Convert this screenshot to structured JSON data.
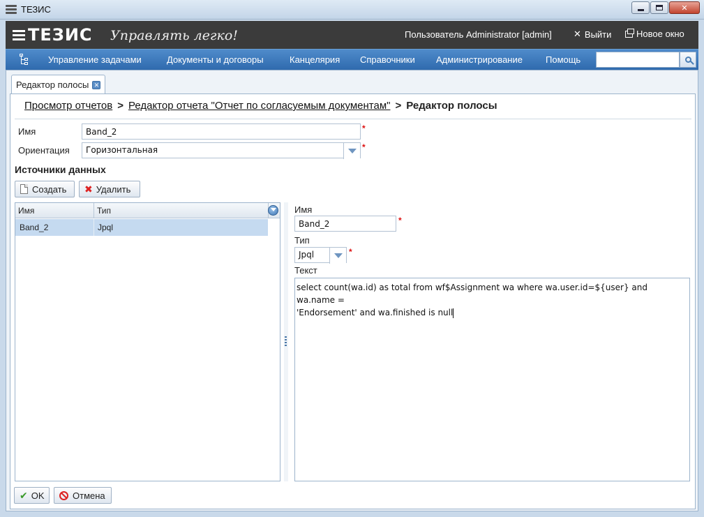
{
  "window": {
    "title": "ТЕЗИС",
    "minimize_label": "",
    "maximize_label": "",
    "close_label": "✕"
  },
  "header": {
    "logo": "ТЕЗИС",
    "slogan": "Управлять легко!",
    "user": "Пользователь Administrator [admin]",
    "exit_label": "Выйти",
    "new_window_label": "Новое окно"
  },
  "menu": {
    "items": [
      "Управление задачами",
      "Документы и договоры",
      "Канцелярия",
      "Справочники",
      "Администрирование",
      "Помощь"
    ],
    "search_placeholder": ""
  },
  "tab": {
    "label": "Редактор полосы"
  },
  "breadcrumb": {
    "link1": "Просмотр отчетов",
    "sep": ">",
    "link2": "Редактор отчета \"Отчет по согласуемым документам\"",
    "current": "Редактор полосы"
  },
  "form": {
    "name_label": "Имя",
    "name_value": "Band_2",
    "orientation_label": "Ориентация",
    "orientation_value": "Горизонтальная",
    "required_mark": "*"
  },
  "datasources": {
    "title": "Источники данных",
    "create_label": "Создать",
    "delete_label": "Удалить",
    "columns": [
      "Имя",
      "Тип"
    ],
    "rows": [
      {
        "name": "Band_2",
        "type": "Jpql"
      }
    ]
  },
  "detail": {
    "name_label": "Имя",
    "name_value": "Band_2",
    "type_label": "Тип",
    "type_value": "Jpql",
    "text_label": "Текст",
    "text_value": "select count(wa.id) as total from wf$Assignment wa where wa.user.id=${user} and wa.name =\n'Endorsement' and wa.finished is null"
  },
  "footer": {
    "ok_label": "OK",
    "cancel_label": "Отмена"
  }
}
